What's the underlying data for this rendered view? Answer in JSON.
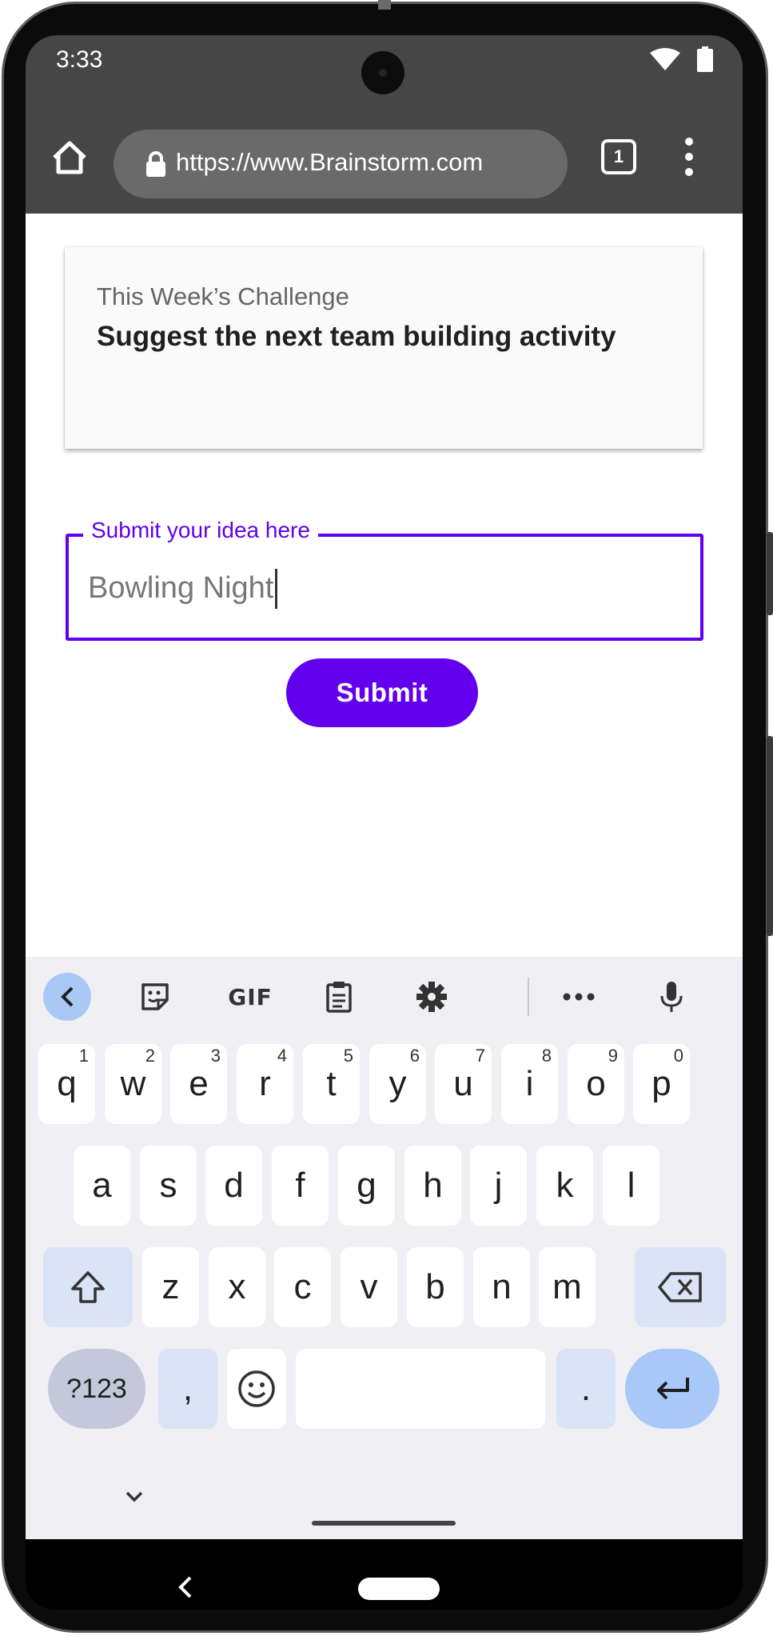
{
  "status_bar": {
    "time": "3:33",
    "icons": [
      "wifi-icon",
      "battery-icon"
    ]
  },
  "browser": {
    "url": "https://www.Brainstorm.com",
    "tab_count": "1",
    "icons": [
      "home-icon",
      "lock-icon",
      "tabs-icon",
      "more-vert-icon"
    ]
  },
  "card": {
    "eyebrow": "This Week’s Challenge",
    "title": "Suggest the next team building activity"
  },
  "idea_field": {
    "label": "Submit your idea here",
    "value": "Bowling Night"
  },
  "submit_label": "Submit",
  "keyboard": {
    "toolbar_icons": [
      "chevron-left-icon",
      "sticker-icon",
      "gif-icon",
      "clipboard-icon",
      "settings-icon",
      "more-horiz-icon",
      "mic-icon"
    ],
    "gif_label": "GIF",
    "row1": [
      {
        "key": "q",
        "hint": "1"
      },
      {
        "key": "w",
        "hint": "2"
      },
      {
        "key": "e",
        "hint": "3"
      },
      {
        "key": "r",
        "hint": "4"
      },
      {
        "key": "t",
        "hint": "5"
      },
      {
        "key": "y",
        "hint": "6"
      },
      {
        "key": "u",
        "hint": "7"
      },
      {
        "key": "i",
        "hint": "8"
      },
      {
        "key": "o",
        "hint": "9"
      },
      {
        "key": "p",
        "hint": "0"
      }
    ],
    "row2": [
      "a",
      "s",
      "d",
      "f",
      "g",
      "h",
      "j",
      "k",
      "l"
    ],
    "row3": [
      "z",
      "x",
      "c",
      "v",
      "b",
      "n",
      "m"
    ],
    "symbols_label": "?123",
    "comma": ",",
    "period": ".",
    "special_icons": [
      "shift-icon",
      "backspace-icon",
      "emoji-icon",
      "enter-icon",
      "keyboard-collapse-icon"
    ]
  },
  "colors": {
    "accent": "#6200ee",
    "browser_chrome": "#464646",
    "keyboard_bg": "#f0eff4"
  }
}
